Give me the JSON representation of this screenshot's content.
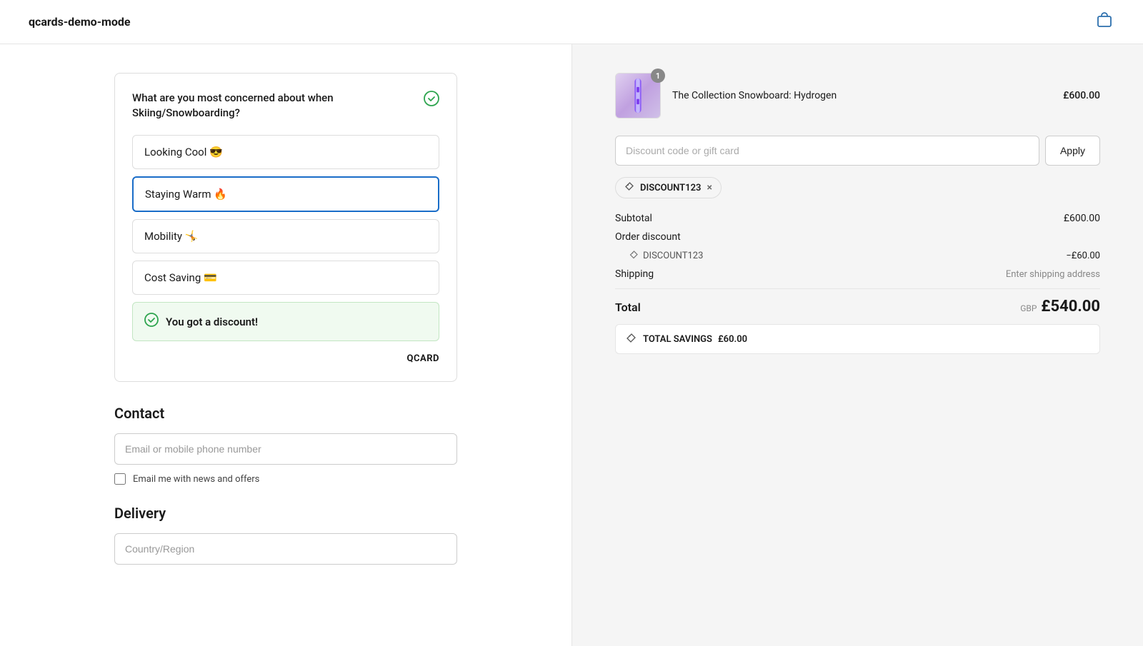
{
  "header": {
    "title": "qcards-demo-mode",
    "cart_icon": "🛍"
  },
  "qcard": {
    "question": "What are you most concerned about when Skiing/Snowboarding?",
    "check_icon": "✓",
    "options": [
      {
        "label": "Looking Cool 😎",
        "selected": false,
        "id": "looking-cool"
      },
      {
        "label": "Staying Warm 🔥",
        "selected": true,
        "id": "staying-warm"
      },
      {
        "label": "Mobility 🤸",
        "selected": false,
        "id": "mobility"
      },
      {
        "label": "Cost Saving 💳",
        "selected": false,
        "id": "cost-saving"
      }
    ],
    "discount_banner": {
      "text": "You got a discount!",
      "check": "✓"
    },
    "brand": "QCARD"
  },
  "contact": {
    "section_title": "Contact",
    "email_placeholder": "Email or mobile phone number",
    "checkbox_label": "Email me with news and offers"
  },
  "delivery": {
    "section_title": "Delivery",
    "country_placeholder": "Country/Region"
  },
  "order_summary": {
    "product": {
      "name": "The Collection Snowboard: Hydrogen",
      "price": "£600.00",
      "badge": "1"
    },
    "discount_input_placeholder": "Discount code or gift card",
    "apply_label": "Apply",
    "applied_code": "DISCOUNT123",
    "subtotal_label": "Subtotal",
    "subtotal_value": "£600.00",
    "order_discount_label": "Order discount",
    "discount_code_display": "DISCOUNT123",
    "discount_value": "−£60.00",
    "shipping_label": "Shipping",
    "shipping_value": "Enter shipping address",
    "total_label": "Total",
    "total_currency": "GBP",
    "total_amount": "£540.00",
    "savings_label": "TOTAL SAVINGS",
    "savings_amount": "£60.00"
  }
}
